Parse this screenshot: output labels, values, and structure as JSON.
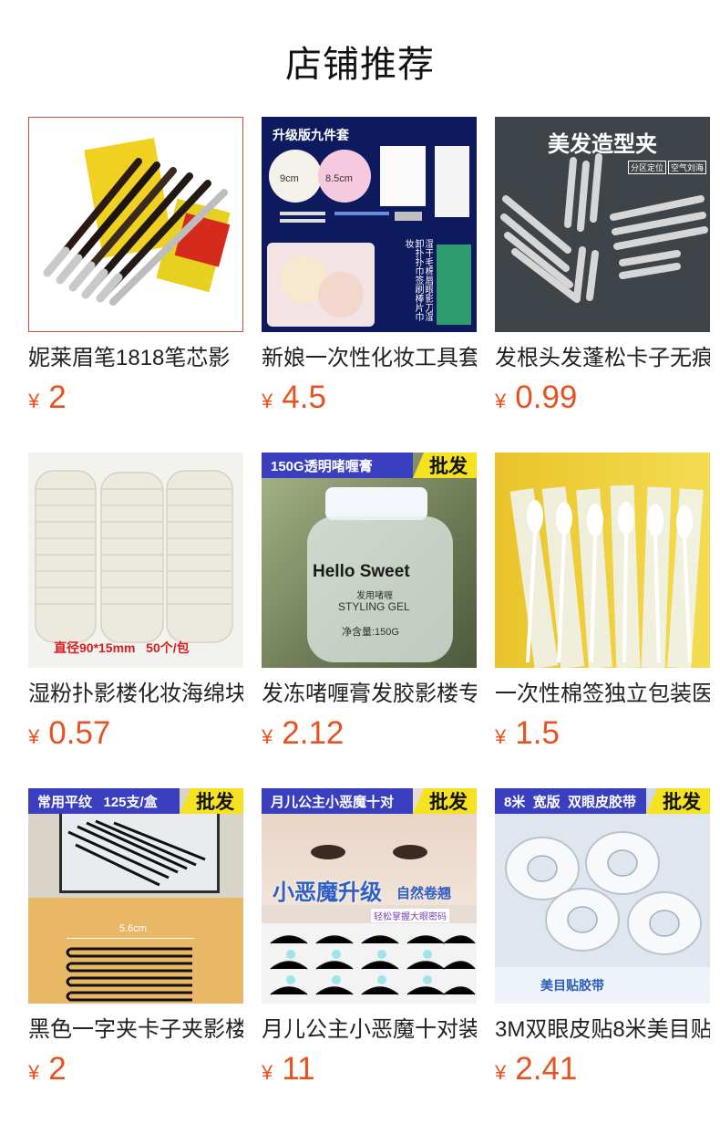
{
  "section": {
    "title": "店铺推荐"
  },
  "currency": "¥",
  "products": [
    {
      "title": "妮莱眉笔1818笔芯影",
      "price": "2"
    },
    {
      "title": "新娘一次性化妆工具套",
      "price": "4.5",
      "image_text": {
        "badge": "升级版九件套",
        "size1": "9cm",
        "size2": "8.5cm",
        "list": "湿干毛棉唇眼影刀湿卸扑扑巾签刷棒片巾妆"
      }
    },
    {
      "title": "发根头发蓬松卡子无痕",
      "price": "0.99",
      "image_text": {
        "badge": "美发造型夹",
        "tag1": "分区定位",
        "tag2": "空气刘海"
      }
    },
    {
      "title": "湿粉扑影楼化妆海绵块",
      "price": "0.57",
      "image_text": {
        "caption": "直径90*15mm   50个/包"
      }
    },
    {
      "title": "发冻啫喱膏发胶影楼专",
      "price": "2.12",
      "image_text": {
        "banner": "150G透明啫喱膏",
        "wholesale": "批发",
        "brand": "Hello Sweet",
        "line1": "发用啫喱",
        "line2": "STYLING GEL",
        "line3": "净含量:150G"
      }
    },
    {
      "title": "一次性棉签独立包装医",
      "price": "1.5"
    },
    {
      "title": "黑色一字夹卡子夹影楼",
      "price": "2",
      "image_text": {
        "banner": "常用平纹   125支/盒",
        "wholesale": "批发",
        "size": "5.6cm"
      }
    },
    {
      "title": "月儿公主小恶魔十对装",
      "price": "11",
      "image_text": {
        "banner": "月儿公主小恶魔十对",
        "wholesale": "批发",
        "headline": "小恶魔升级",
        "sub": "自然卷翘",
        "line": "轻松掌握大眼密码"
      }
    },
    {
      "title": "3M双眼皮贴8米美目贴",
      "price": "2.41",
      "image_text": {
        "banner": "8米  宽版  双眼皮胶带",
        "wholesale": "批发",
        "box": "美目贴胶带"
      }
    }
  ],
  "colors": {
    "price": "#e8521f",
    "banner_blue": "#3a3fc0",
    "banner_yellow": "#f5e321"
  }
}
